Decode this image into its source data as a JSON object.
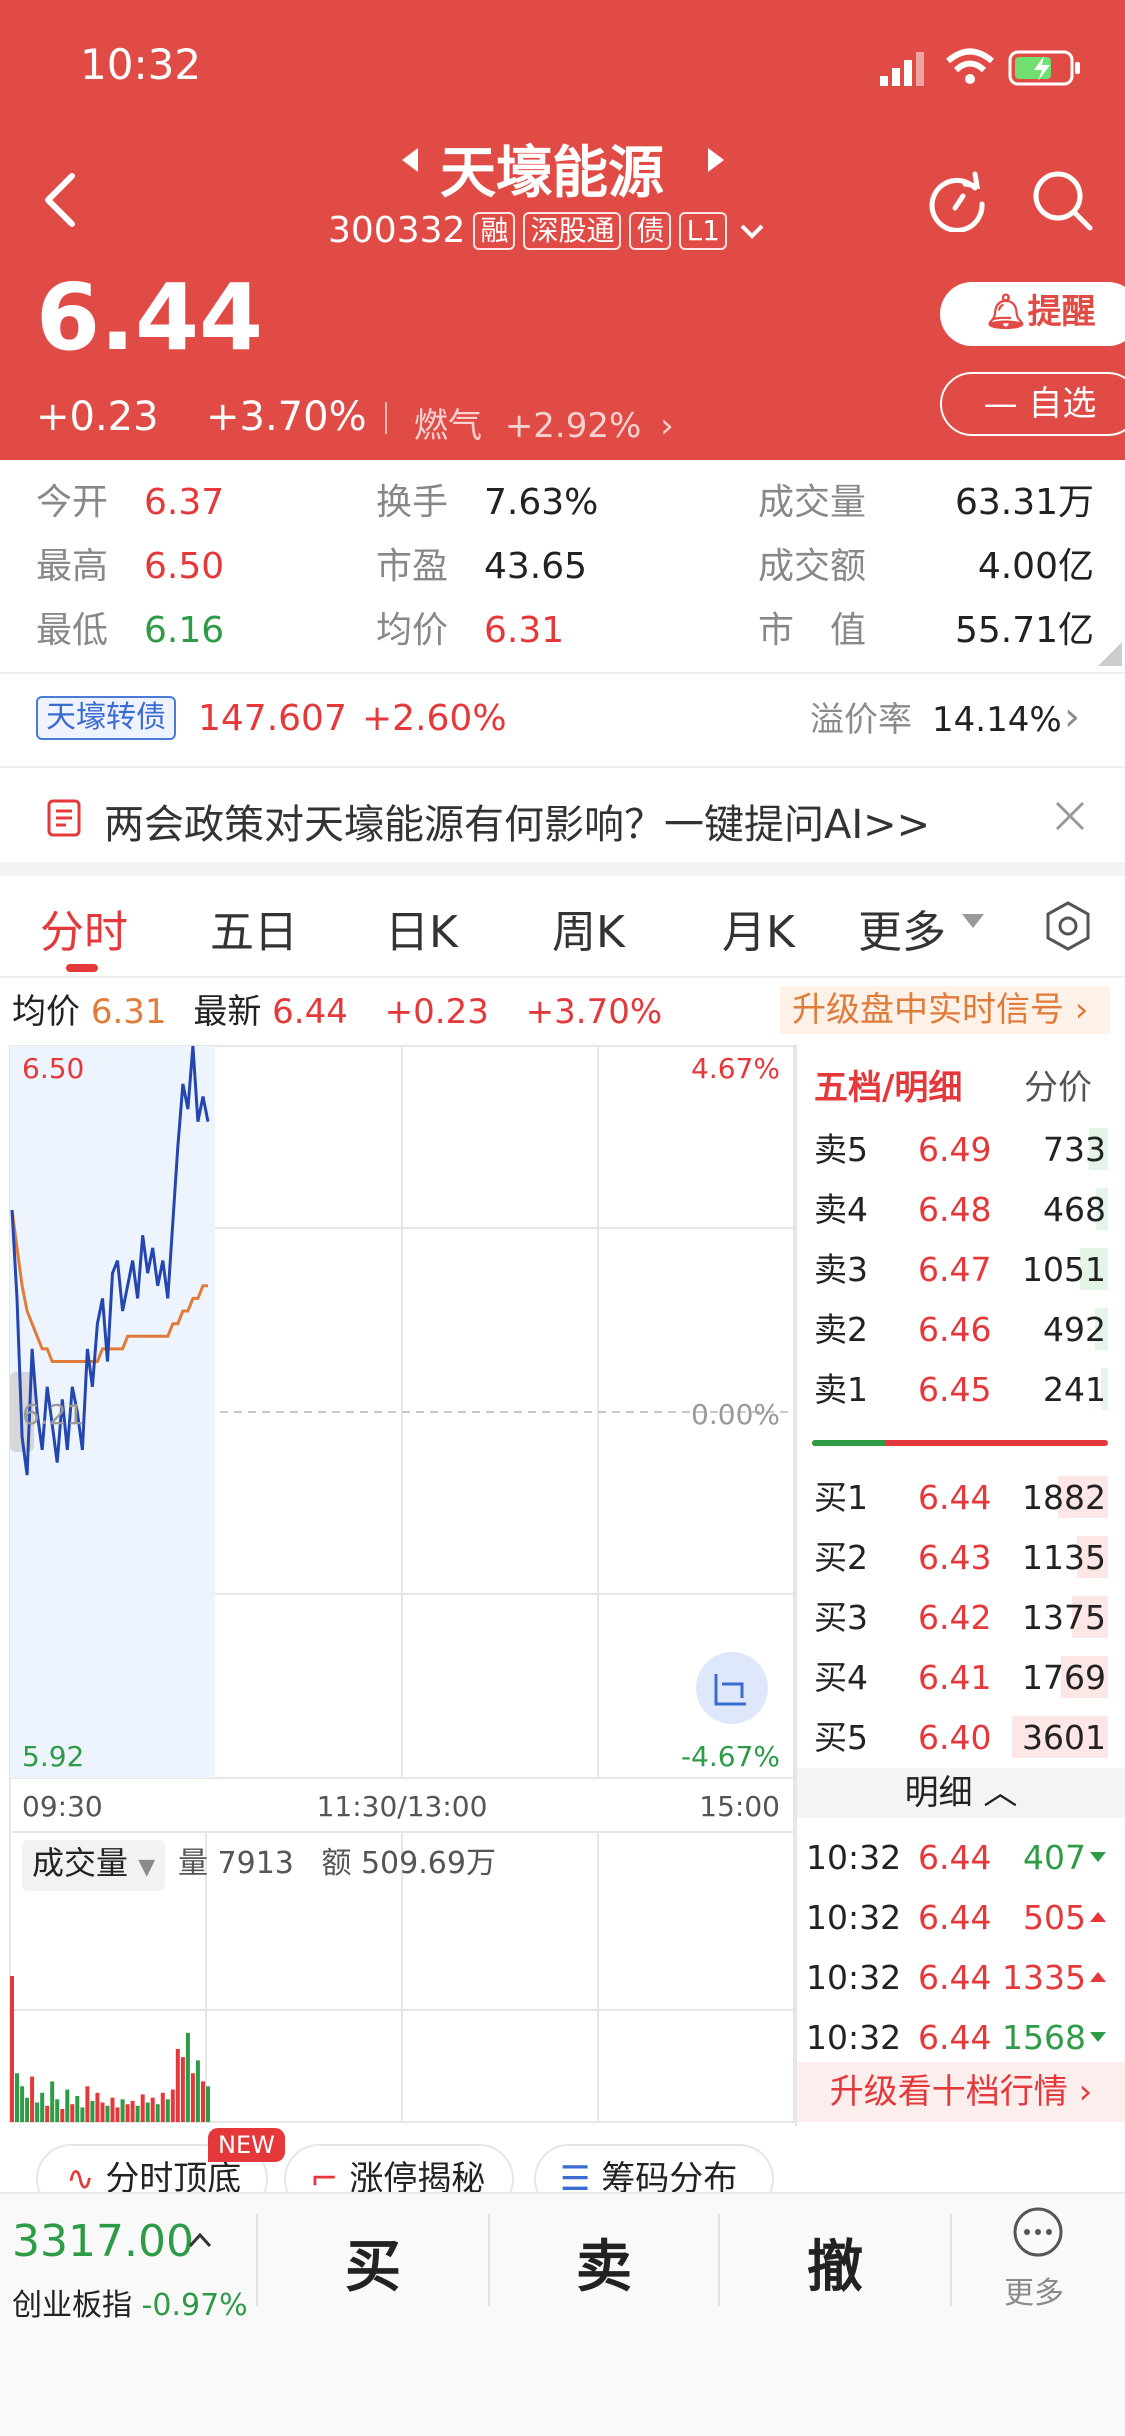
{
  "status": {
    "time": "10:32"
  },
  "stock": {
    "name": "天壕能源",
    "code": "300332",
    "tags": [
      "融",
      "深股通",
      "债",
      "L1"
    ]
  },
  "quote": {
    "price": "6.44",
    "change": "+0.23",
    "change_pct": "+3.70%",
    "sector": "燃气",
    "sector_change": "+2.92%"
  },
  "header": {
    "alert_label": "提醒",
    "watchlist_label": "自选"
  },
  "stats": [
    {
      "label": "今开",
      "value": "6.37"
    },
    {
      "label": "换手",
      "value": "7.63%"
    },
    {
      "label": "成交量",
      "value": "63.31万"
    },
    {
      "label": "最高",
      "value": "6.50"
    },
    {
      "label": "市盈",
      "value": "43.65"
    },
    {
      "label": "成交额",
      "value": "4.00亿"
    },
    {
      "label": "最低",
      "value": "6.16"
    },
    {
      "label": "均价",
      "value": "6.31"
    },
    {
      "label": "市　值",
      "value": "55.71亿"
    }
  ],
  "bond": {
    "name": "天壕转债",
    "price": "147.607",
    "change": "+2.60%",
    "premium_label": "溢价率",
    "premium_value": "14.14%"
  },
  "banner": {
    "text": "两会政策对天壕能源有何影响？一键提问AI>>"
  },
  "tabs": [
    "分时",
    "五日",
    "日K",
    "周K",
    "月K",
    "更多"
  ],
  "chart_info": {
    "avg_label": "均价",
    "avg_value": "6.31",
    "latest_label": "最新",
    "latest_value": "6.44",
    "change": "+0.23",
    "change_pct": "+3.70%",
    "upgrade_signal": "升级盘中实时信号"
  },
  "chart_data": {
    "type": "line",
    "y_labels": {
      "max": "6.50",
      "prev_close": "6.21",
      "min": "5.92"
    },
    "pct_labels": {
      "max": "4.67%",
      "zero": "0.00%",
      "min": "-4.67%"
    },
    "time_labels": [
      "09:30",
      "11:30/13:00",
      "15:00"
    ],
    "ylim": [
      5.92,
      6.5
    ],
    "x_minutes_total": 240,
    "series": [
      {
        "name": "最新",
        "values": [
          6.37,
          6.3,
          6.19,
          6.16,
          6.26,
          6.21,
          6.18,
          6.23,
          6.2,
          6.17,
          6.22,
          6.18,
          6.23,
          6.21,
          6.18,
          6.26,
          6.23,
          6.28,
          6.3,
          6.25,
          6.32,
          6.33,
          6.29,
          6.31,
          6.33,
          6.3,
          6.35,
          6.32,
          6.34,
          6.31,
          6.33,
          6.3,
          6.36,
          6.42,
          6.47,
          6.45,
          6.5,
          6.44,
          6.46,
          6.44
        ]
      },
      {
        "name": "均价",
        "values": [
          6.37,
          6.34,
          6.31,
          6.29,
          6.28,
          6.27,
          6.26,
          6.26,
          6.25,
          6.25,
          6.25,
          6.25,
          6.25,
          6.25,
          6.25,
          6.25,
          6.25,
          6.25,
          6.26,
          6.26,
          6.26,
          6.26,
          6.26,
          6.27,
          6.27,
          6.27,
          6.27,
          6.27,
          6.27,
          6.27,
          6.27,
          6.27,
          6.28,
          6.28,
          6.29,
          6.29,
          6.3,
          6.3,
          6.31,
          6.31
        ]
      }
    ],
    "volume": [
      90,
      30,
      22,
      15,
      28,
      12,
      18,
      10,
      25,
      14,
      8,
      20,
      11,
      16,
      9,
      22,
      13,
      18,
      12,
      10,
      15,
      9,
      14,
      11,
      13,
      10,
      17,
      12,
      15,
      11,
      18,
      14,
      20,
      45,
      40,
      55,
      30,
      38,
      25,
      22
    ]
  },
  "volume": {
    "label": "成交量",
    "qty": "量 7913",
    "amount": "额 509.69万"
  },
  "order_book": {
    "title": "五档/明细",
    "tab2": "分价",
    "asks": [
      {
        "label": "卖5",
        "price": "6.49",
        "vol": "733",
        "depth": 0.2
      },
      {
        "label": "卖4",
        "price": "6.48",
        "vol": "468",
        "depth": 0.13
      },
      {
        "label": "卖3",
        "price": "6.47",
        "vol": "1051",
        "depth": 0.29
      },
      {
        "label": "卖2",
        "price": "6.46",
        "vol": "492",
        "depth": 0.14
      },
      {
        "label": "卖1",
        "price": "6.45",
        "vol": "241",
        "depth": 0.07
      }
    ],
    "bids": [
      {
        "label": "买1",
        "price": "6.44",
        "vol": "1882",
        "depth": 0.52
      },
      {
        "label": "买2",
        "price": "6.43",
        "vol": "1135",
        "depth": 0.32
      },
      {
        "label": "买3",
        "price": "6.42",
        "vol": "1375",
        "depth": 0.38
      },
      {
        "label": "买4",
        "price": "6.41",
        "vol": "1769",
        "depth": 0.49
      },
      {
        "label": "买5",
        "price": "6.40",
        "vol": "3601",
        "depth": 1.0
      }
    ],
    "detail_label": "明细",
    "ticks": [
      {
        "time": "10:32",
        "price": "6.44",
        "vol": "407",
        "dir": "down"
      },
      {
        "time": "10:32",
        "price": "6.44",
        "vol": "505",
        "dir": "up"
      },
      {
        "time": "10:32",
        "price": "6.44",
        "vol": "1335",
        "dir": "up"
      },
      {
        "time": "10:32",
        "price": "6.44",
        "vol": "1568",
        "dir": "down"
      }
    ],
    "upgrade_label": "升级看十档行情"
  },
  "chips": [
    "分时顶底",
    "涨停揭秘",
    "筹码分布"
  ],
  "chips_badge": "NEW",
  "bottom": {
    "index_value": "3317.00",
    "index_name": "创业板指",
    "index_change": "-0.97%",
    "buy": "买",
    "sell": "卖",
    "cancel": "撤",
    "more": "更多"
  },
  "colors": {
    "header_red": "#e14b45",
    "up": "#e5383b",
    "down": "#2e9b46",
    "avg_line": "#e07b39",
    "price_line": "#2346b0"
  }
}
